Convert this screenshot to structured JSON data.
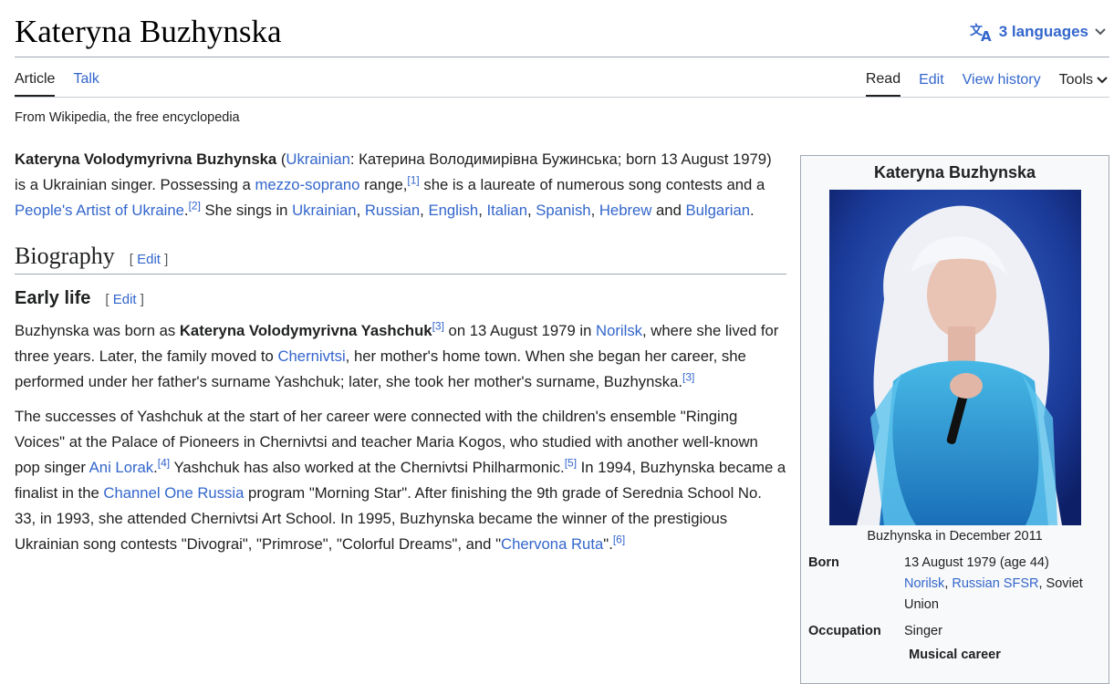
{
  "page": {
    "title": "Kateryna Buzhynska",
    "languages_label": "3 languages",
    "tagline": "From Wikipedia, the free encyclopedia"
  },
  "tabs": {
    "article": "Article",
    "talk": "Talk",
    "read": "Read",
    "edit": "Edit",
    "history": "View history",
    "tools": "Tools"
  },
  "intro": {
    "s1_bold": "Kateryna Volodymyrivna Buzhynska",
    "s1_paren_open": " (",
    "s1_lang_link": "Ukrainian",
    "s1_text": ": Катерина Володимирівна Бужинська; born 13 August 1979) is a Ukrainian singer. Possessing a ",
    "s1_mezzo": "mezzo-soprano",
    "s1_range": " range,",
    "ref1": "[1]",
    "s2_text": " she is a laureate of numerous song contests and a ",
    "s2_pa_link": "People's Artist of Ukraine",
    "s2_dot": ".",
    "ref2": "[2]",
    "s3_text": " She sings in ",
    "l_ukrainian": "Ukrainian",
    "l_russian": "Russian",
    "l_english": "English",
    "l_italian": "Italian",
    "l_spanish": "Spanish",
    "l_hebrew": "Hebrew",
    "l_bulgarian": "Bulgarian",
    "comma": ", ",
    "and": " and ",
    "end": "."
  },
  "sections": {
    "biography": "Biography",
    "early_life": "Early life",
    "edit_label": "[ edit ]"
  },
  "early": {
    "p1_a": "Buzhynska was born as ",
    "p1_bold": "Kateryna Volodymyrivna Yashchuk",
    "ref3": "[3]",
    "p1_b": " on 13 August 1979 in ",
    "p1_norilsk": "Norilsk",
    "p1_c": ", where she lived for three years. Later, the family moved to ",
    "p1_chernivtsi": "Chernivtsi",
    "p1_d": ", her mother's home town. When she began her career, she performed under her father's surname Yashchuk; later, she took her mother's surname, Buzhynska.",
    "p2_a": "The successes of Yashchuk at the start of her career were connected with the children's ensemble \"Ringing Voices\" at the Palace of Pioneers in Chernivtsi and teacher Maria Kogos, who studied with another well-known pop singer ",
    "p2_lorak": "Ani Lorak",
    "p2_dot": ".",
    "ref4": "[4]",
    "p2_b": " Yashchuk has also worked at the Chernivtsi Philharmonic.",
    "ref5": "[5]",
    "p2_c": " In 1994, Buzhynska became a finalist in the ",
    "p2_channel": "Channel One Russia",
    "p2_d": " program \"Morning Star\". After finishing the 9th grade of Serednia School No. 33, in 1993, she attended Chernivtsi Art School. In 1995, Buzhynska became the winner of the prestigious Ukrainian song contests \"Divograi\", \"Primrose\", \"Colorful Dreams\", and \"",
    "p2_ruta": "Chervona Ruta",
    "p2_e": "\".",
    "ref6": "[6]"
  },
  "infobox": {
    "title": "Kateryna Buzhynska",
    "caption": "Buzhynska in December 2011",
    "born_label": "Born",
    "born_date": "13 August 1979 (age 44)",
    "born_norilsk": "Norilsk",
    "born_sep": ", ",
    "born_sfsr": "Russian SFSR",
    "born_rest": ", Soviet Union",
    "occupation_label": "Occupation",
    "occupation_value": "Singer",
    "musical_career": "Musical career"
  },
  "colors": {
    "link": "#3366cc",
    "text": "#202122",
    "infobox_bg": "#f8f9fa",
    "border": "#a2a9b1"
  },
  "icons": {
    "language": "translate-icon",
    "chevron": "chevron-down-icon"
  }
}
